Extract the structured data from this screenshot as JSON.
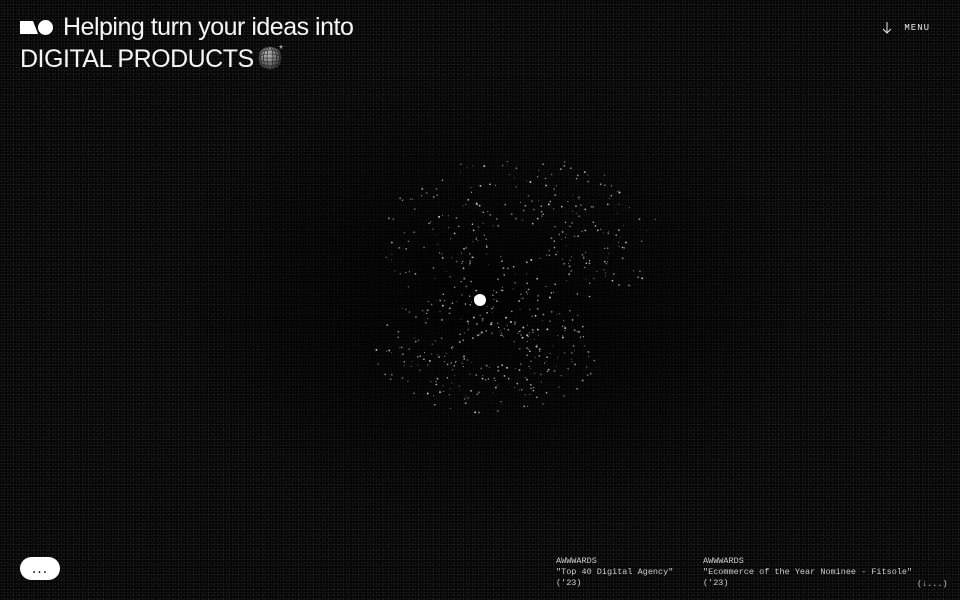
{
  "header": {
    "logo_icon": "studio-logo-icon",
    "headline_line1": "Helping turn your ideas into",
    "headline_line2": "DIGITAL PRODUCTS",
    "globe_icon": "wireframe-globe-icon",
    "asterisk": "*"
  },
  "nav": {
    "menu_label": "MENU",
    "menu_icon": "arrow-down-icon"
  },
  "hero": {
    "visual": "particle-cloud",
    "center_marker": "white-dot"
  },
  "chat": {
    "label": "..."
  },
  "awards": [
    {
      "org": "AWWWARDS",
      "title": "\"Top 40 Digital Agency\"",
      "year": "('23)"
    },
    {
      "org": "AWWWARDS",
      "title": "\"Ecommerce of the Year Nominee - Fitsole\"",
      "year": "('23)"
    }
  ],
  "scroll_hint": "(↓...)",
  "colors": {
    "background": "#050505",
    "foreground": "#f5f5f5",
    "muted": "#cfcfcf"
  }
}
